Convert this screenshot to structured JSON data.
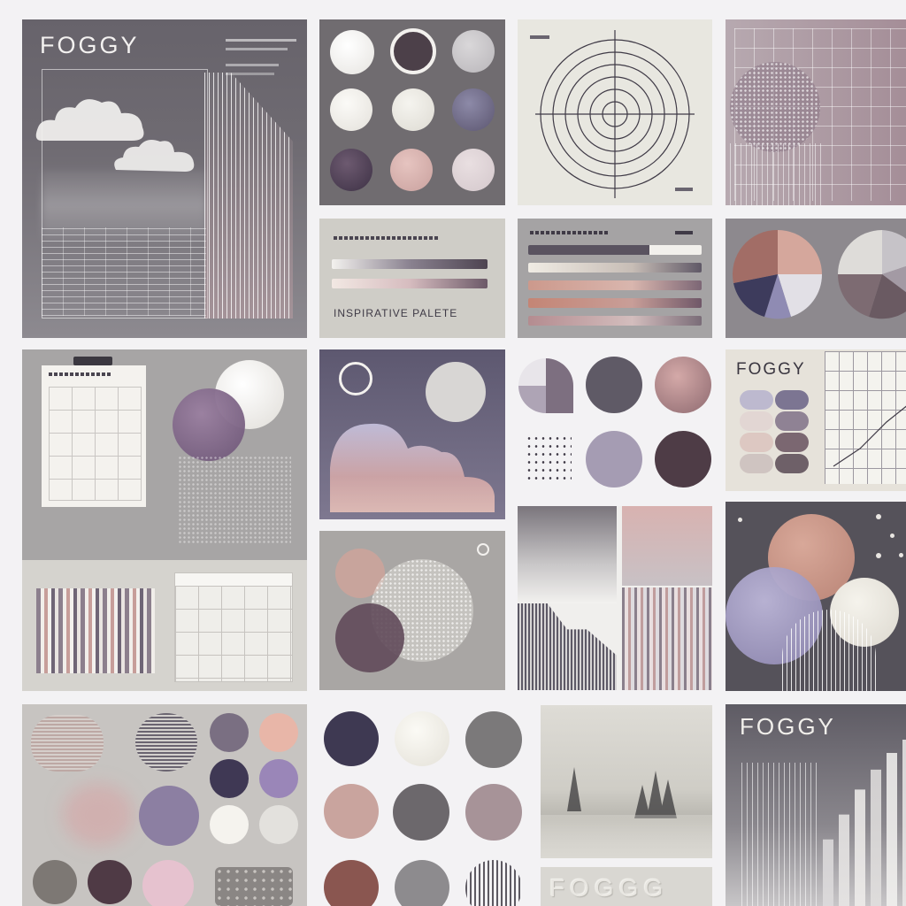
{
  "cards": {
    "foggy_poster_top": {
      "title": "FOGGY"
    },
    "palette_bars": {
      "caption": "INSPIRATIVE PALETE"
    },
    "foggy_swatch_card": {
      "title": "FOGGY"
    },
    "foggy_poster_bottom": {
      "title": "FOGGY"
    },
    "foggy_footer": {
      "text": "FOGGG"
    }
  },
  "colors": {
    "page_bg": "#f3f2f4",
    "charcoal": "#6e6a72",
    "mist_gray": "#bdbbb8",
    "ivory": "#f1efe9",
    "plum": "#4d3f4f",
    "lavender": "#8e82a0",
    "dusty_rose": "#c9a19a",
    "blush": "#e8c9c2",
    "navy_dusk": "#3f3a56",
    "clay": "#8a5a52"
  }
}
